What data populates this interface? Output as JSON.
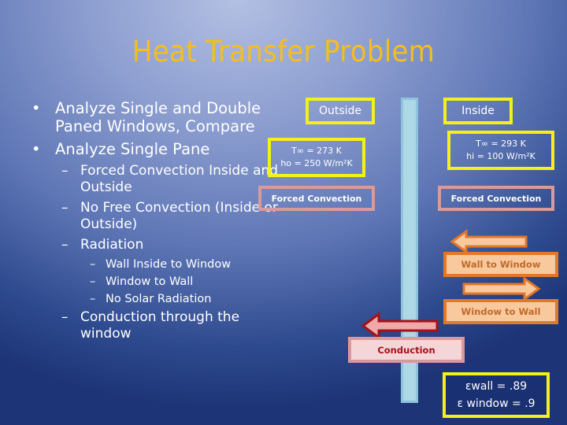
{
  "title": "Heat Transfer Problem",
  "bullets": {
    "b1": "Analyze Single and Double Paned Windows, Compare",
    "b2": "Analyze Single Pane",
    "s1": "Forced Convection Inside and Outside",
    "s2": "No Free Convection (Inside or Outside)",
    "s3": "Radiation",
    "ss1": "Wall Inside to Window",
    "ss2": "Window to Wall",
    "ss3": "No Solar Radiation",
    "s4": "Conduction through the window",
    "bullet_marker": "•",
    "dash_marker": "–"
  },
  "diagram": {
    "outside_label": "Outside",
    "inside_label": "Inside",
    "outside_params": {
      "line1": "T∞ = 273 K",
      "line2": "ho = 250 W/m²K"
    },
    "inside_params": {
      "line1": "T∞ = 293 K",
      "line2": "hi = 100 W/m²K"
    },
    "outside_mode": "Forced Convection",
    "inside_mode": "Forced Convection",
    "rad_wall_to_window": "Wall to Window",
    "rad_window_to_wall": "Window to Wall",
    "conduction": "Conduction",
    "emissivity": {
      "line1": "εwall = .89",
      "line2": "ε window = .9"
    }
  },
  "colors": {
    "title": "#f4be20",
    "yellow_border": "#f5f01a",
    "pink_border": "#d89a9a",
    "orange": "#e2782a",
    "orange_fill": "#f9c99e",
    "red": "#a4111a",
    "pane": "#add8e6"
  }
}
